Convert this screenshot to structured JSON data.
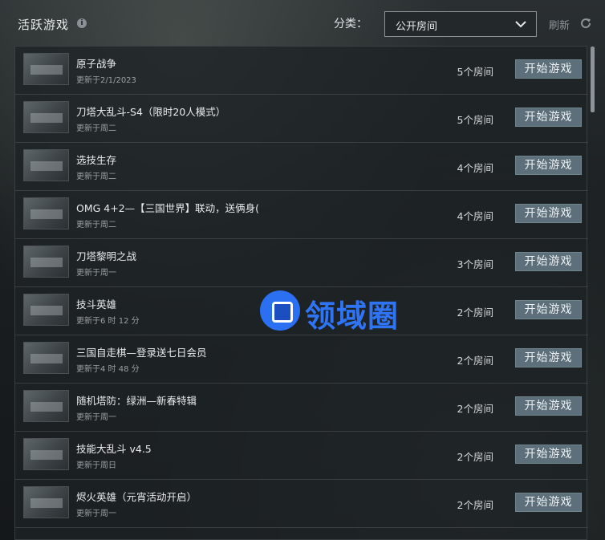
{
  "header": {
    "title": "活跃游戏",
    "info_icon": "i",
    "category_label": "分类：",
    "category_selected": "公开房间",
    "refresh_label": "刷新"
  },
  "games": [
    {
      "name": "原子战争",
      "updated": "更新于2/1/2023",
      "rooms": "5个房间",
      "play": "开始游戏"
    },
    {
      "name": "刀塔大乱斗-S4（限时20人模式）",
      "updated": "更新于周二",
      "rooms": "5个房间",
      "play": "开始游戏"
    },
    {
      "name": "选技生存",
      "updated": "更新于周二",
      "rooms": "4个房间",
      "play": "开始游戏"
    },
    {
      "name": "OMG 4+2—【三国世界】联动，送俩身(",
      "updated": "更新于周二",
      "rooms": "4个房间",
      "play": "开始游戏"
    },
    {
      "name": "刀塔黎明之战",
      "updated": "更新于周一",
      "rooms": "3个房间",
      "play": "开始游戏"
    },
    {
      "name": "技斗英雄",
      "updated": "更新于6 时 12 分",
      "rooms": "2个房间",
      "play": "开始游戏"
    },
    {
      "name": "三国自走棋—登录送七日会员",
      "updated": "更新于4 时 48 分",
      "rooms": "2个房间",
      "play": "开始游戏"
    },
    {
      "name": "随机塔防：绿洲—新春特辑",
      "updated": "更新于周一",
      "rooms": "2个房间",
      "play": "开始游戏"
    },
    {
      "name": "技能大乱斗 v4.5",
      "updated": "更新于周日",
      "rooms": "2个房间",
      "play": "开始游戏"
    },
    {
      "name": "烬火英雄（元宵活动开启）",
      "updated": "更新于周一",
      "rooms": "2个房间",
      "play": "开始游戏"
    }
  ],
  "watermark": {
    "text": "领域圈"
  },
  "colors": {
    "accent_button": "#5c6f7a",
    "watermark_blue": "#2f74f5"
  },
  "icons": {
    "info": "info-icon",
    "dropdown": "chevron-down-icon",
    "refresh": "refresh-icon",
    "watermark": "logo-icon"
  }
}
